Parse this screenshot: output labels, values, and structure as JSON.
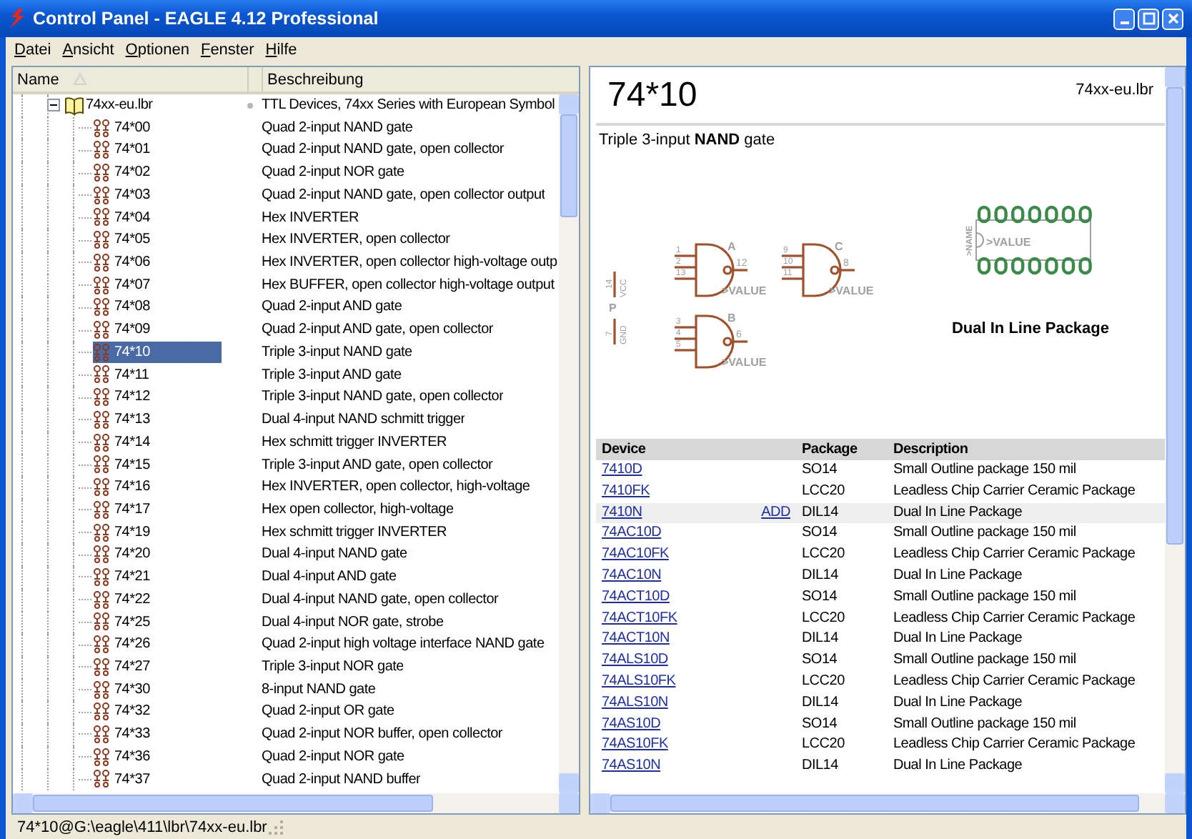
{
  "window": {
    "title": "Control Panel - EAGLE 4.12 Professional"
  },
  "menu": [
    "Datei",
    "Ansicht",
    "Optionen",
    "Fenster",
    "Hilfe"
  ],
  "tree": {
    "columns": [
      "Name",
      "Beschreibung"
    ],
    "items": [
      {
        "name": "74xx-eu.lbr",
        "description": "TTL Devices, 74xx Series with European Symbol",
        "expanded": true,
        "selected": false,
        "children": [
          {
            "name": "74*00",
            "description": "Quad 2-input NAND gate",
            "selected": false
          },
          {
            "name": "74*01",
            "description": "Quad 2-input NAND gate, open collector",
            "selected": false
          },
          {
            "name": "74*02",
            "description": "Quad 2-input NOR gate",
            "selected": false
          },
          {
            "name": "74*03",
            "description": "Quad 2-input NAND gate, open collector output",
            "selected": false
          },
          {
            "name": "74*04",
            "description": "Hex INVERTER",
            "selected": false
          },
          {
            "name": "74*05",
            "description": "Hex INVERTER, open collector",
            "selected": false
          },
          {
            "name": "74*06",
            "description": "Hex INVERTER, open collector high-voltage outp",
            "selected": false
          },
          {
            "name": "74*07",
            "description": "Hex BUFFER, open collector high-voltage output",
            "selected": false
          },
          {
            "name": "74*08",
            "description": "Quad 2-input AND gate",
            "selected": false
          },
          {
            "name": "74*09",
            "description": "Quad 2-input AND gate, open collector",
            "selected": false
          },
          {
            "name": "74*10",
            "description": "Triple 3-input NAND gate",
            "selected": true
          },
          {
            "name": "74*11",
            "description": "Triple 3-input AND gate",
            "selected": false
          },
          {
            "name": "74*12",
            "description": "Triple 3-input NAND gate, open collector",
            "selected": false
          },
          {
            "name": "74*13",
            "description": "Dual 4-input NAND schmitt trigger",
            "selected": false
          },
          {
            "name": "74*14",
            "description": "Hex schmitt trigger INVERTER",
            "selected": false
          },
          {
            "name": "74*15",
            "description": "Triple 3-input AND gate, open collector",
            "selected": false
          },
          {
            "name": "74*16",
            "description": "Hex INVERTER, open collector, high-voltage",
            "selected": false
          },
          {
            "name": "74*17",
            "description": "Hex open collector, high-voltage",
            "selected": false
          },
          {
            "name": "74*19",
            "description": "Hex schmitt trigger INVERTER",
            "selected": false
          },
          {
            "name": "74*20",
            "description": "Dual 4-input NAND gate",
            "selected": false
          },
          {
            "name": "74*21",
            "description": "Dual 4-input AND gate",
            "selected": false
          },
          {
            "name": "74*22",
            "description": "Dual 4-input NAND gate, open collector",
            "selected": false
          },
          {
            "name": "74*25",
            "description": "Dual 4-input NOR gate, strobe",
            "selected": false
          },
          {
            "name": "74*26",
            "description": "Quad 2-input high voltage interface NAND gate",
            "selected": false
          },
          {
            "name": "74*27",
            "description": "Triple 3-input NOR gate",
            "selected": false
          },
          {
            "name": "74*30",
            "description": "8-input NAND gate",
            "selected": false
          },
          {
            "name": "74*32",
            "description": "Quad 2-input OR gate",
            "selected": false
          },
          {
            "name": "74*33",
            "description": "Quad 2-input NOR buffer, open collector",
            "selected": false
          },
          {
            "name": "74*36",
            "description": "Quad 2-input NOR gate",
            "selected": false
          },
          {
            "name": "74*37",
            "description": "Quad 2-input NAND buffer",
            "selected": false
          }
        ]
      }
    ]
  },
  "detail": {
    "title": "74*10",
    "library": "74xx-eu.lbr",
    "description": "Triple 3-input **NAND** gate",
    "schematic": {
      "gates": [
        {
          "name": "A",
          "inputs": [
            "1",
            "2",
            "13"
          ],
          "output": "12",
          "value": ">VALUE"
        },
        {
          "name": "C",
          "inputs": [
            "9",
            "10",
            "11"
          ],
          "output": "8",
          "value": ">VALUE"
        },
        {
          "name": "B",
          "inputs": [
            "3",
            "4",
            "5"
          ],
          "output": "6",
          "value": ">VALUE"
        }
      ],
      "power": {
        "name": "P",
        "pins": [
          {
            "number": "14",
            "signal": "VCC"
          },
          {
            "number": "7",
            "signal": "GND"
          }
        ]
      }
    },
    "package": {
      "value": ">VALUE",
      "name": ">NAME",
      "caption": "Dual In Line Package"
    },
    "table": {
      "columns": [
        "Device",
        "Package",
        "Description"
      ],
      "rows": [
        {
          "device": "7410D",
          "package": "SO14",
          "description": "Small Outline package 150 mil",
          "selected": false
        },
        {
          "device": "7410FK",
          "package": "LCC20",
          "description": "Leadless Chip Carrier Ceramic Package",
          "selected": false
        },
        {
          "device": "7410N",
          "action": "ADD",
          "package": "DIL14",
          "description": "Dual In Line Package",
          "selected": true
        },
        {
          "device": "74AC10D",
          "package": "SO14",
          "description": "Small Outline package 150 mil",
          "selected": false
        },
        {
          "device": "74AC10FK",
          "package": "LCC20",
          "description": "Leadless Chip Carrier Ceramic Package",
          "selected": false
        },
        {
          "device": "74AC10N",
          "package": "DIL14",
          "description": "Dual In Line Package",
          "selected": false
        },
        {
          "device": "74ACT10D",
          "package": "SO14",
          "description": "Small Outline package 150 mil",
          "selected": false
        },
        {
          "device": "74ACT10FK",
          "package": "LCC20",
          "description": "Leadless Chip Carrier Ceramic Package",
          "selected": false
        },
        {
          "device": "74ACT10N",
          "package": "DIL14",
          "description": "Dual In Line Package",
          "selected": false
        },
        {
          "device": "74ALS10D",
          "package": "SO14",
          "description": "Small Outline package 150 mil",
          "selected": false
        },
        {
          "device": "74ALS10FK",
          "package": "LCC20",
          "description": "Leadless Chip Carrier Ceramic Package",
          "selected": false
        },
        {
          "device": "74ALS10N",
          "package": "DIL14",
          "description": "Dual In Line Package",
          "selected": false
        },
        {
          "device": "74AS10D",
          "package": "SO14",
          "description": "Small Outline package 150 mil",
          "selected": false
        },
        {
          "device": "74AS10FK",
          "package": "LCC20",
          "description": "Leadless Chip Carrier Ceramic Package",
          "selected": false
        },
        {
          "device": "74AS10N",
          "package": "DIL14",
          "description": "Dual In Line Package",
          "selected": false
        }
      ]
    }
  },
  "status_bar": "74*10@G:\\eagle\\411\\lbr\\74xx-eu.lbr"
}
